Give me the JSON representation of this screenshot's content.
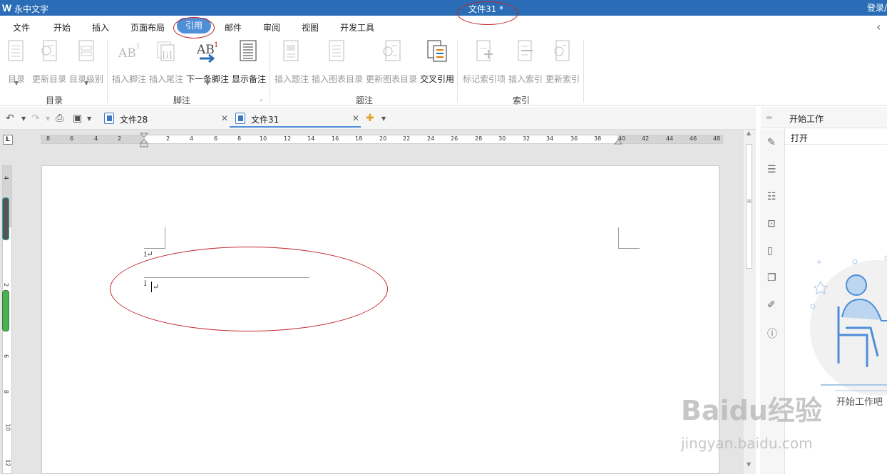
{
  "titlebar": {
    "app_name": "永中文字",
    "doc_title": "文件31 *",
    "login": "登录/"
  },
  "menu": [
    "文件",
    "开始",
    "插入",
    "页面布局",
    "引用",
    "邮件",
    "审阅",
    "视图",
    "开发工具"
  ],
  "ribbon": {
    "buttons": [
      {
        "label": "目录",
        "enabled": false,
        "icon": "toc-icon"
      },
      {
        "label": "更新目录",
        "enabled": false,
        "icon": "update-toc-icon"
      },
      {
        "label": "目录级别",
        "enabled": false,
        "icon": "toc-level-icon"
      },
      {
        "label": "插入脚注",
        "enabled": false,
        "icon": "insert-footnote-icon"
      },
      {
        "label": "插入尾注",
        "enabled": false,
        "icon": "insert-endnote-icon"
      },
      {
        "label": "下一条脚注",
        "enabled": true,
        "icon": "next-footnote-icon"
      },
      {
        "label": "显示备注",
        "enabled": true,
        "icon": "show-notes-icon"
      },
      {
        "label": "插入题注",
        "enabled": false,
        "icon": "insert-caption-icon"
      },
      {
        "label": "插入图表目录",
        "enabled": false,
        "icon": "insert-figure-toc-icon"
      },
      {
        "label": "更新图表目录",
        "enabled": false,
        "icon": "update-figure-toc-icon"
      },
      {
        "label": "交叉引用",
        "enabled": true,
        "icon": "cross-reference-icon"
      },
      {
        "label": "标记索引项",
        "enabled": false,
        "icon": "mark-index-icon"
      },
      {
        "label": "插入索引",
        "enabled": false,
        "icon": "insert-index-icon"
      },
      {
        "label": "更新索引",
        "enabled": false,
        "icon": "update-index-icon"
      }
    ],
    "groups": [
      "目录",
      "脚注",
      "题注",
      "索引"
    ],
    "icon_text": {
      "footnote": "AB",
      "footnote_sup": "1",
      "endnote": "[i]"
    }
  },
  "tabs": [
    {
      "label": "文件28",
      "active": false
    },
    {
      "label": "文件31",
      "active": true
    }
  ],
  "ruler": {
    "h_ticks": [
      "8",
      "6",
      "4",
      "2",
      "2",
      "4",
      "6",
      "8",
      "10",
      "12",
      "14",
      "16",
      "18",
      "20",
      "22",
      "24",
      "26",
      "28",
      "30",
      "32",
      "34",
      "36",
      "38",
      "40",
      "42",
      "44",
      "46",
      "48"
    ],
    "v_ticks": [
      "4",
      "2",
      "2",
      "4",
      "6",
      "8",
      "10",
      "12"
    ],
    "corner": "L"
  },
  "document": {
    "line1": "i↵",
    "line2": "i",
    "line2_mark": "↵"
  },
  "side_panel": {
    "title": "开始工作",
    "open": "打开",
    "start": "开始工作吧"
  },
  "watermark": {
    "main": "Baidu经验",
    "sub": "jingyan.baidu.com"
  },
  "colors": {
    "titlebar": "#2a6db6",
    "accent": "#4f8fd8",
    "annotation": "#c0262b"
  }
}
